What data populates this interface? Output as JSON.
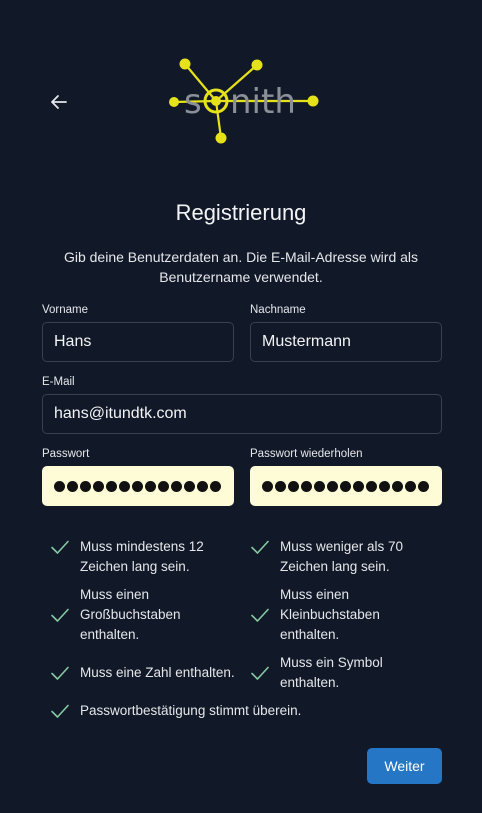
{
  "logo": {
    "text_left": "s",
    "text_right": "nith",
    "accent": "#e6e21a"
  },
  "page": {
    "title": "Registrierung",
    "subtitle": "Gib deine Benutzerdaten an. Die E-Mail-Adresse wird als Benutzername verwendet."
  },
  "form": {
    "firstname": {
      "label": "Vorname",
      "value": "Hans"
    },
    "lastname": {
      "label": "Nachname",
      "value": "Mustermann"
    },
    "email": {
      "label": "E-Mail",
      "value": "hans@itundtk.com"
    },
    "password": {
      "label": "Passwort",
      "masked_count": 13
    },
    "password_repeat": {
      "label": "Passwort wiederholen",
      "masked_count": 13
    }
  },
  "rules": [
    "Muss mindestens 12 Zeichen lang sein.",
    "Muss weniger als 70 Zeichen lang sein.",
    "Muss einen Großbuchstaben enthalten.",
    "Muss einen Kleinbuchstaben enthalten.",
    "Muss eine Zahl enthalten.",
    "Muss ein Symbol enthalten.",
    "Passwortbestätigung stimmt überein."
  ],
  "actions": {
    "next_label": "Weiter"
  },
  "icons": {
    "back": "arrow-left-icon",
    "check": "check-icon"
  },
  "colors": {
    "background": "#111827",
    "primary": "#2676c6",
    "check": "#86c9a0",
    "password_bg": "#fefbd7"
  }
}
